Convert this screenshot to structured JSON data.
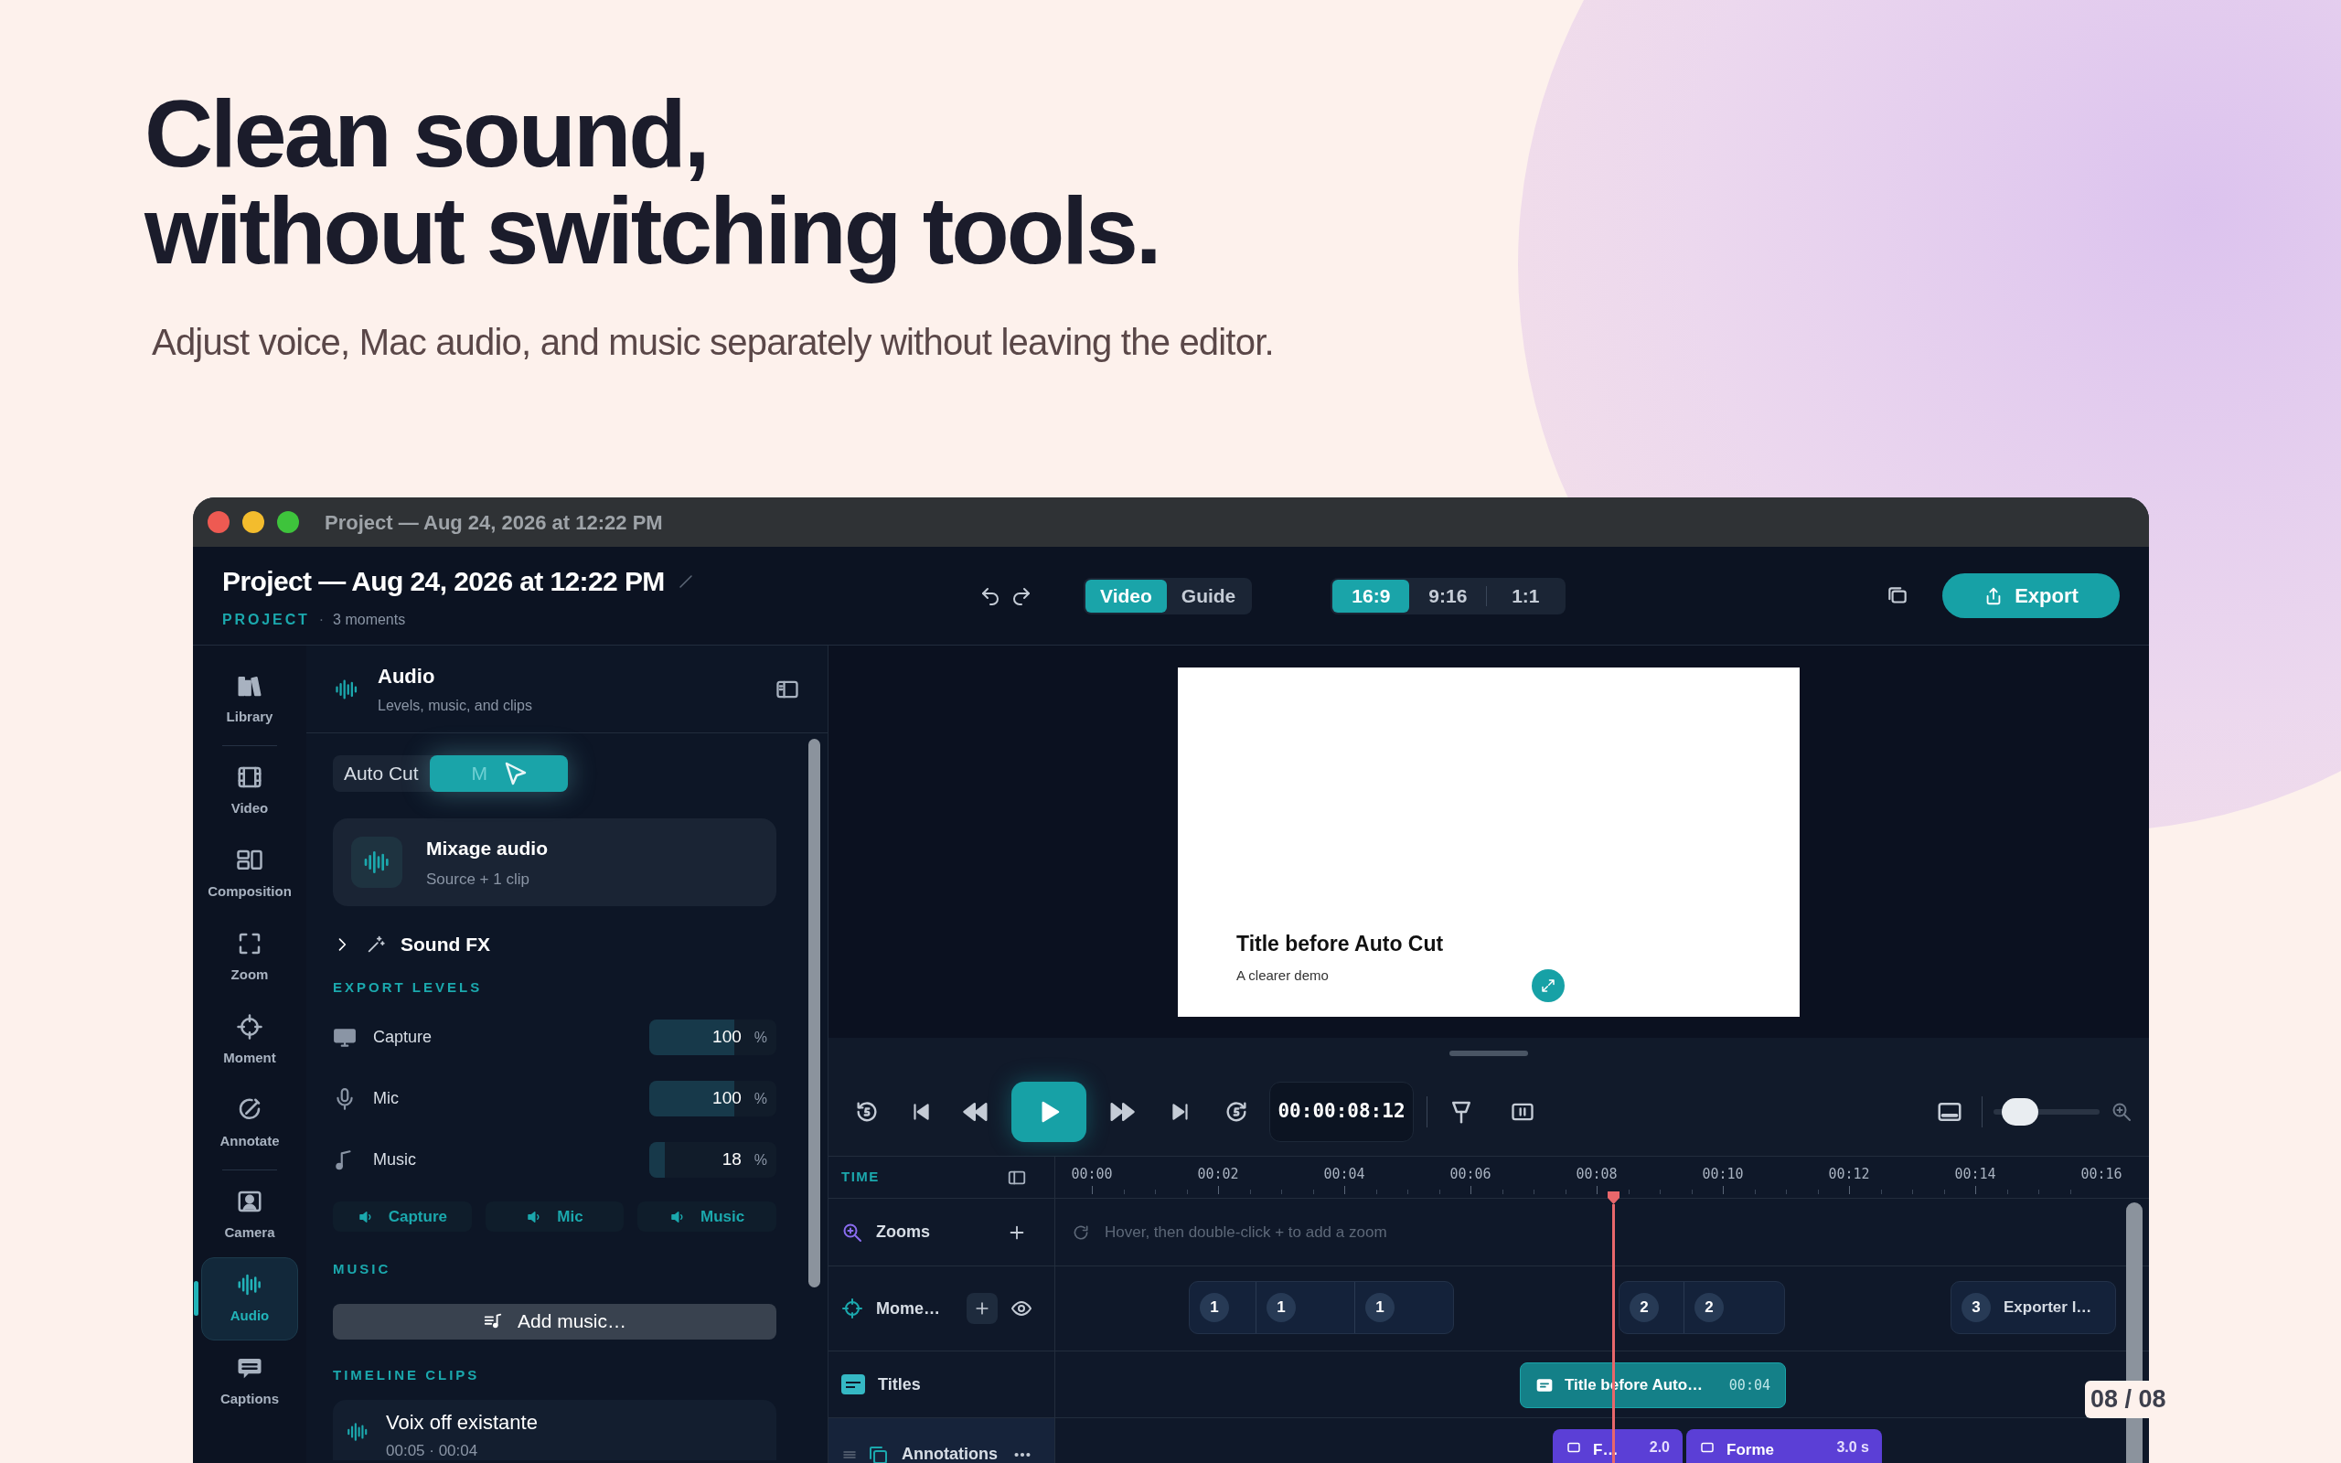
{
  "page": {
    "headline": [
      "Clean sound,",
      "without switching tools."
    ],
    "subtitle": "Adjust voice, Mac audio, and music separately without leaving the editor.",
    "counter": "08 / 08"
  },
  "window": {
    "title": "Project — Aug 24, 2026 at 12:22 PM"
  },
  "header": {
    "title": "Project — Aug 24, 2026 at 12:22 PM",
    "tag": "PROJECT",
    "separator": "·",
    "meta": "3 moments",
    "view_tabs": [
      {
        "label": "Video",
        "selected": true
      },
      {
        "label": "Guide",
        "selected": false
      }
    ],
    "ratios": [
      {
        "label": "16:9",
        "selected": true
      },
      {
        "label": "9:16",
        "selected": false
      },
      {
        "label": "1:1",
        "selected": false
      }
    ],
    "export_button": "Export"
  },
  "sidebar": {
    "items": [
      {
        "label": "Library",
        "selected": false
      },
      {
        "label": "Video",
        "selected": false
      },
      {
        "label": "Composition",
        "selected": false
      },
      {
        "label": "Zoom",
        "selected": false
      },
      {
        "label": "Moment",
        "selected": false
      },
      {
        "label": "Annotate",
        "selected": false
      },
      {
        "label": "Camera",
        "selected": false
      },
      {
        "label": "Audio",
        "selected": true
      },
      {
        "label": "Captions",
        "selected": false
      }
    ]
  },
  "panel": {
    "title": "Audio",
    "subtitle": "Levels, music, and clips",
    "mode_tabs": [
      {
        "label": "Auto Cut",
        "selected": false
      },
      {
        "label": "M",
        "selected": true
      }
    ],
    "mix_card": {
      "title": "Mixage audio",
      "subtitle": "Source + 1 clip"
    },
    "sound_fx": {
      "label": "Sound FX",
      "expanded": false
    },
    "export_levels": {
      "heading": "EXPORT LEVELS",
      "rows": [
        {
          "label": "Capture",
          "value": "100",
          "unit": "%",
          "level": 0.667
        },
        {
          "label": "Mic",
          "value": "100",
          "unit": "%",
          "level": 0.667
        },
        {
          "label": "Music",
          "value": "18",
          "unit": "%",
          "level": 0.12
        }
      ]
    },
    "mute_buttons": [
      {
        "label": "Capture"
      },
      {
        "label": "Mic"
      },
      {
        "label": "Music"
      }
    ],
    "music": {
      "heading": "MUSIC",
      "button": "Add music…"
    },
    "timeline_clips": {
      "heading": "TIMELINE CLIPS",
      "items": [
        {
          "title": "Voix off existante",
          "subtitle": "00:05 · 00:04"
        }
      ]
    }
  },
  "preview": {
    "title": "Title before Auto Cut",
    "subtitle": "A clearer demo"
  },
  "transport": {
    "timecode": "00:00:08:12",
    "zoom": {
      "level": 0.14
    }
  },
  "timeline": {
    "header": "TIME",
    "ticks": [
      "00:00",
      "00:02",
      "00:04",
      "00:06",
      "00:08",
      "00:10",
      "00:12",
      "00:14",
      "00:16"
    ],
    "tracks": [
      {
        "kind": "zooms",
        "label": "Zooms",
        "hint": "Hover, then double-click + to add a zoom"
      },
      {
        "kind": "moments",
        "label": "Mome…",
        "groups": [
          {
            "segments": [
              "1",
              "1",
              "1"
            ]
          },
          {
            "segments": [
              "2",
              "2"
            ]
          },
          {
            "segments": [
              "3"
            ],
            "label": "Exporter l…"
          }
        ]
      },
      {
        "kind": "titles",
        "label": "Titles",
        "clips": [
          {
            "title": "Title before Auto…",
            "duration": "00:04"
          }
        ]
      },
      {
        "kind": "annotations",
        "label": "Annotations",
        "clips": [
          {
            "title": "F…",
            "duration": "2.0"
          },
          {
            "title": "Forme",
            "duration": "3.0 s"
          }
        ]
      }
    ]
  }
}
